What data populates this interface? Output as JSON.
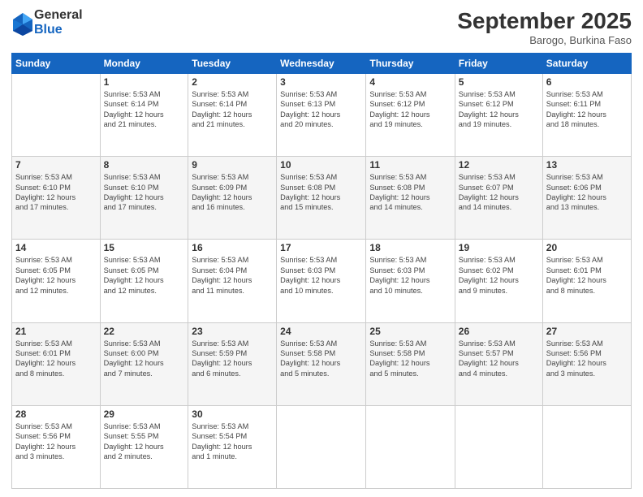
{
  "logo": {
    "general": "General",
    "blue": "Blue"
  },
  "header": {
    "month": "September 2025",
    "location": "Barogo, Burkina Faso"
  },
  "weekdays": [
    "Sunday",
    "Monday",
    "Tuesday",
    "Wednesday",
    "Thursday",
    "Friday",
    "Saturday"
  ],
  "weeks": [
    [
      {
        "day": "",
        "info": ""
      },
      {
        "day": "1",
        "info": "Sunrise: 5:53 AM\nSunset: 6:14 PM\nDaylight: 12 hours\nand 21 minutes."
      },
      {
        "day": "2",
        "info": "Sunrise: 5:53 AM\nSunset: 6:14 PM\nDaylight: 12 hours\nand 21 minutes."
      },
      {
        "day": "3",
        "info": "Sunrise: 5:53 AM\nSunset: 6:13 PM\nDaylight: 12 hours\nand 20 minutes."
      },
      {
        "day": "4",
        "info": "Sunrise: 5:53 AM\nSunset: 6:12 PM\nDaylight: 12 hours\nand 19 minutes."
      },
      {
        "day": "5",
        "info": "Sunrise: 5:53 AM\nSunset: 6:12 PM\nDaylight: 12 hours\nand 19 minutes."
      },
      {
        "day": "6",
        "info": "Sunrise: 5:53 AM\nSunset: 6:11 PM\nDaylight: 12 hours\nand 18 minutes."
      }
    ],
    [
      {
        "day": "7",
        "info": "Sunrise: 5:53 AM\nSunset: 6:10 PM\nDaylight: 12 hours\nand 17 minutes."
      },
      {
        "day": "8",
        "info": "Sunrise: 5:53 AM\nSunset: 6:10 PM\nDaylight: 12 hours\nand 17 minutes."
      },
      {
        "day": "9",
        "info": "Sunrise: 5:53 AM\nSunset: 6:09 PM\nDaylight: 12 hours\nand 16 minutes."
      },
      {
        "day": "10",
        "info": "Sunrise: 5:53 AM\nSunset: 6:08 PM\nDaylight: 12 hours\nand 15 minutes."
      },
      {
        "day": "11",
        "info": "Sunrise: 5:53 AM\nSunset: 6:08 PM\nDaylight: 12 hours\nand 14 minutes."
      },
      {
        "day": "12",
        "info": "Sunrise: 5:53 AM\nSunset: 6:07 PM\nDaylight: 12 hours\nand 14 minutes."
      },
      {
        "day": "13",
        "info": "Sunrise: 5:53 AM\nSunset: 6:06 PM\nDaylight: 12 hours\nand 13 minutes."
      }
    ],
    [
      {
        "day": "14",
        "info": "Sunrise: 5:53 AM\nSunset: 6:05 PM\nDaylight: 12 hours\nand 12 minutes."
      },
      {
        "day": "15",
        "info": "Sunrise: 5:53 AM\nSunset: 6:05 PM\nDaylight: 12 hours\nand 12 minutes."
      },
      {
        "day": "16",
        "info": "Sunrise: 5:53 AM\nSunset: 6:04 PM\nDaylight: 12 hours\nand 11 minutes."
      },
      {
        "day": "17",
        "info": "Sunrise: 5:53 AM\nSunset: 6:03 PM\nDaylight: 12 hours\nand 10 minutes."
      },
      {
        "day": "18",
        "info": "Sunrise: 5:53 AM\nSunset: 6:03 PM\nDaylight: 12 hours\nand 10 minutes."
      },
      {
        "day": "19",
        "info": "Sunrise: 5:53 AM\nSunset: 6:02 PM\nDaylight: 12 hours\nand 9 minutes."
      },
      {
        "day": "20",
        "info": "Sunrise: 5:53 AM\nSunset: 6:01 PM\nDaylight: 12 hours\nand 8 minutes."
      }
    ],
    [
      {
        "day": "21",
        "info": "Sunrise: 5:53 AM\nSunset: 6:01 PM\nDaylight: 12 hours\nand 8 minutes."
      },
      {
        "day": "22",
        "info": "Sunrise: 5:53 AM\nSunset: 6:00 PM\nDaylight: 12 hours\nand 7 minutes."
      },
      {
        "day": "23",
        "info": "Sunrise: 5:53 AM\nSunset: 5:59 PM\nDaylight: 12 hours\nand 6 minutes."
      },
      {
        "day": "24",
        "info": "Sunrise: 5:53 AM\nSunset: 5:58 PM\nDaylight: 12 hours\nand 5 minutes."
      },
      {
        "day": "25",
        "info": "Sunrise: 5:53 AM\nSunset: 5:58 PM\nDaylight: 12 hours\nand 5 minutes."
      },
      {
        "day": "26",
        "info": "Sunrise: 5:53 AM\nSunset: 5:57 PM\nDaylight: 12 hours\nand 4 minutes."
      },
      {
        "day": "27",
        "info": "Sunrise: 5:53 AM\nSunset: 5:56 PM\nDaylight: 12 hours\nand 3 minutes."
      }
    ],
    [
      {
        "day": "28",
        "info": "Sunrise: 5:53 AM\nSunset: 5:56 PM\nDaylight: 12 hours\nand 3 minutes."
      },
      {
        "day": "29",
        "info": "Sunrise: 5:53 AM\nSunset: 5:55 PM\nDaylight: 12 hours\nand 2 minutes."
      },
      {
        "day": "30",
        "info": "Sunrise: 5:53 AM\nSunset: 5:54 PM\nDaylight: 12 hours\nand 1 minute."
      },
      {
        "day": "",
        "info": ""
      },
      {
        "day": "",
        "info": ""
      },
      {
        "day": "",
        "info": ""
      },
      {
        "day": "",
        "info": ""
      }
    ]
  ]
}
